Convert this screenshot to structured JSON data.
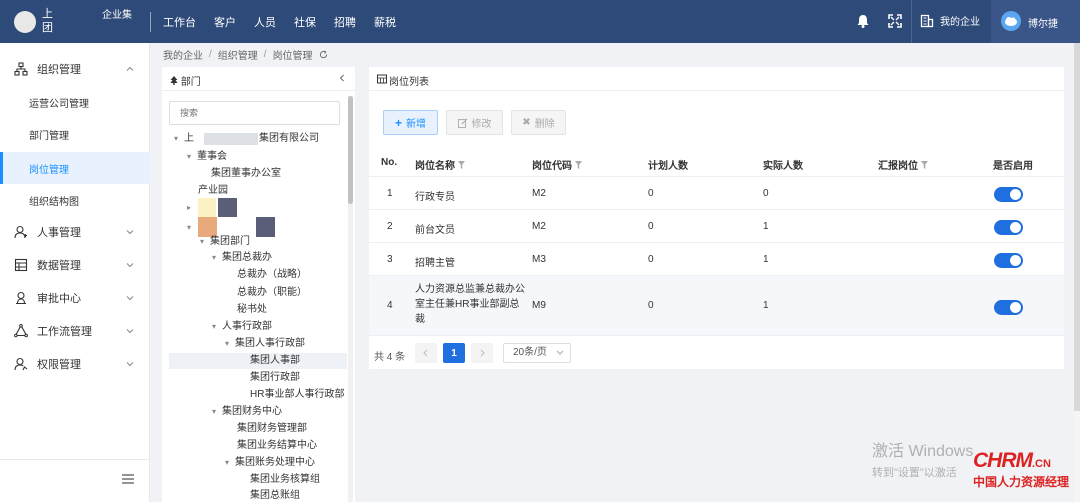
{
  "topbar": {
    "logo_text": "上 团",
    "company": "企业集",
    "nav": [
      "工作台",
      "客户",
      "人员",
      "社保",
      "招聘",
      "薪税"
    ],
    "my_enterprise": "我的企业",
    "user_name": "博尔捷"
  },
  "sidebar": {
    "sections": [
      {
        "label": "组织管理",
        "icon": "org-icon",
        "expanded": true
      },
      {
        "label": "人事管理",
        "icon": "person-icon"
      },
      {
        "label": "数据管理",
        "icon": "data-icon"
      },
      {
        "label": "审批中心",
        "icon": "approval-icon"
      },
      {
        "label": "工作流管理",
        "icon": "workflow-icon"
      },
      {
        "label": "权限管理",
        "icon": "permission-icon"
      }
    ],
    "sub_items": [
      "运营公司管理",
      "部门管理",
      "岗位管理",
      "组织结构图"
    ],
    "active_sub": "岗位管理"
  },
  "breadcrumb": [
    "我的企业",
    "组织管理",
    "岗位管理"
  ],
  "dept_panel": {
    "title": "部门",
    "search_placeholder": "搜索",
    "tree": [
      "上",
      "集团有限公司",
      "董事会",
      "集团董事办公室",
      "产业园",
      "集团部门",
      "集团总裁办",
      "总裁办（战略）",
      "总裁办（职能）",
      "秘书处",
      "人事行政部",
      "集团人事行政部",
      "集团人事部",
      "集团行政部",
      "HR事业部人事行政部",
      "集团财务中心",
      "集团财务管理部",
      "集团业务结算中心",
      "集团账务处理中心",
      "集团业务核算组",
      "集团总账组"
    ]
  },
  "main": {
    "title": "岗位列表",
    "buttons": {
      "add": "新增",
      "edit": "修改",
      "delete": "删除"
    },
    "columns": [
      "No.",
      "岗位名称",
      "岗位代码",
      "计划人数",
      "实际人数",
      "汇报岗位",
      "是否启用"
    ],
    "rows": [
      {
        "no": "1",
        "name": "行政专员",
        "code": "M2",
        "plan": "0",
        "actual": "0",
        "report": "",
        "enabled": true
      },
      {
        "no": "2",
        "name": "前台文员",
        "code": "M2",
        "plan": "0",
        "actual": "1",
        "report": "",
        "enabled": true
      },
      {
        "no": "3",
        "name": "招聘主管",
        "code": "M3",
        "plan": "0",
        "actual": "1",
        "report": "",
        "enabled": true
      },
      {
        "no": "4",
        "name": "人力资源总监兼总裁办公室主任兼HR事业部副总裁",
        "code": "M9",
        "plan": "0",
        "actual": "1",
        "report": "",
        "enabled": true
      }
    ],
    "pager": {
      "total": "共 4 条",
      "current": "1",
      "page_size": "20条/页"
    }
  },
  "watermark": {
    "line1": "激活 Windows",
    "line2": "转到\"设置\"以激活",
    "brand": "CHRM",
    "brand_suffix": ".CN",
    "brand_zh": "中国人力资源经理"
  },
  "colors": {
    "topbar": "#2e4a79",
    "primary": "#1890ff",
    "toggle": "#1f6fe0"
  }
}
